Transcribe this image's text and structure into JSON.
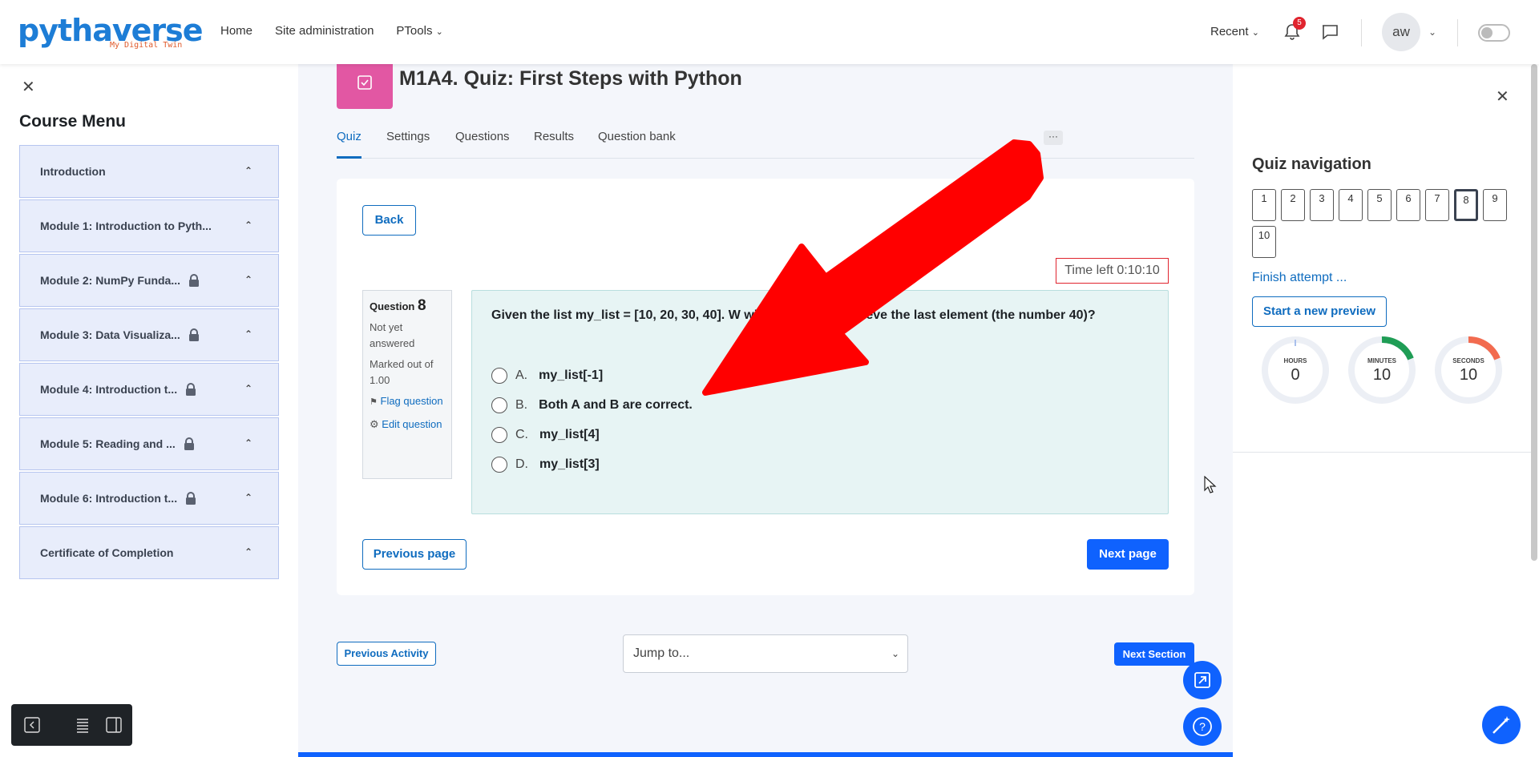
{
  "brand": {
    "word": "pythaverse",
    "tagline": "My Digital Twin"
  },
  "nav": {
    "home": "Home",
    "site_admin": "Site administration",
    "ptools": "PTools",
    "recent": "Recent",
    "notifications_count": "5",
    "avatar_initials": "aw"
  },
  "course_menu": {
    "title": "Course Menu",
    "items": [
      {
        "label": "Introduction",
        "locked": false
      },
      {
        "label": "Module 1: Introduction to Pyth...",
        "locked": false
      },
      {
        "label": "Module 2: NumPy Funda...",
        "locked": true
      },
      {
        "label": "Module 3: Data Visualiza...",
        "locked": true
      },
      {
        "label": "Module 4: Introduction t...",
        "locked": true
      },
      {
        "label": "Module 5: Reading and ...",
        "locked": true
      },
      {
        "label": "Module 6: Introduction t...",
        "locked": true
      },
      {
        "label": "Certificate of Completion",
        "locked": false
      }
    ]
  },
  "page": {
    "title": "M1A4. Quiz: First Steps with Python",
    "tabs": [
      "Quiz",
      "Settings",
      "Questions",
      "Results",
      "Question bank"
    ],
    "more": "···"
  },
  "quiz": {
    "back": "Back",
    "time_left": "Time left 0:10:10",
    "question_label": "Question",
    "question_number": "8",
    "status": "Not yet answered",
    "marked": "Marked out of 1.00",
    "flag": "Flag question",
    "edit": "Edit question",
    "question_text": "Given the list my_list = [10, 20, 30, 40]. W                        will access and retrieve the last element (the number 40)?",
    "options": [
      {
        "letter": "A.",
        "text": "my_list[-1]"
      },
      {
        "letter": "B.",
        "text": "Both A and B are correct."
      },
      {
        "letter": "C.",
        "text": "my_list[4]"
      },
      {
        "letter": "D.",
        "text": "my_list[3]"
      }
    ],
    "previous_page": "Previous page",
    "next_page": "Next page"
  },
  "activity_nav": {
    "previous": "Previous Activity",
    "jump": "Jump to...",
    "next": "Next Section"
  },
  "quiz_navigation": {
    "title": "Quiz navigation",
    "buttons": [
      "1",
      "2",
      "3",
      "4",
      "5",
      "6",
      "7",
      "8",
      "9",
      "10"
    ],
    "current": "8",
    "finish": "Finish attempt ...",
    "new_preview": "Start a new preview",
    "timer": [
      {
        "label": "HOURS",
        "value": "0"
      },
      {
        "label": "MINUTES",
        "value": "10"
      },
      {
        "label": "SECONDS",
        "value": "10"
      }
    ]
  },
  "colors": {
    "primary": "#0f62fe",
    "quiz_icon": "#e257a3",
    "arrow": "#ff0000",
    "danger": "#e0242e"
  }
}
